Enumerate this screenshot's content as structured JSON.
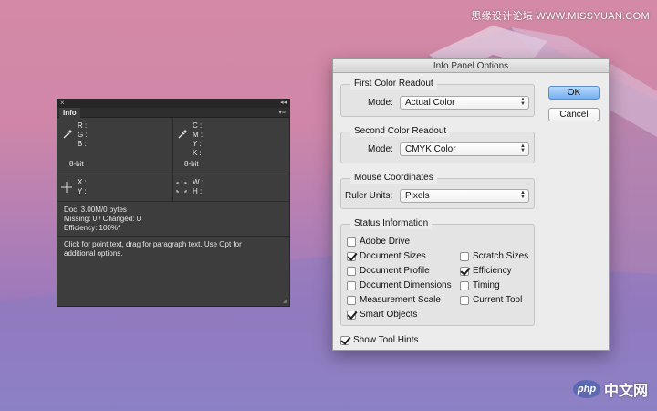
{
  "watermark": {
    "top_text": "思缘设计论坛 WWW.MISSYUAN.COM",
    "logo_text": "php",
    "logo_cn": "中文网"
  },
  "info_panel": {
    "close_glyph": "×",
    "collapse_glyph": "◂◂",
    "tab_label": "Info",
    "menu_glyph": "▾≡",
    "rgb_labels": [
      "R :",
      "G :",
      "B :"
    ],
    "rgb_bitdepth": "8-bit",
    "cmyk_labels": [
      "C :",
      "M :",
      "Y :",
      "K :"
    ],
    "cmyk_bitdepth": "8-bit",
    "xy_labels": [
      "X :",
      "Y :"
    ],
    "wh_labels": [
      "W :",
      "H :"
    ],
    "status_lines": [
      "Doc: 3.00M/0 bytes",
      "Missing: 0 / Changed: 0",
      "Efficiency: 100%*"
    ],
    "hint_lines": [
      "Click for point text, drag for paragraph text.  Use Opt for",
      "additional options."
    ]
  },
  "dialog": {
    "title": "Info Panel Options",
    "ok_label": "OK",
    "cancel_label": "Cancel",
    "first_readout": {
      "group_label": "First Color Readout",
      "mode_label": "Mode:",
      "mode_value": "Actual Color"
    },
    "second_readout": {
      "group_label": "Second Color Readout",
      "mode_label": "Mode:",
      "mode_value": "CMYK Color"
    },
    "mouse": {
      "group_label": "Mouse Coordinates",
      "units_label": "Ruler Units:",
      "units_value": "Pixels"
    },
    "status": {
      "group_label": "Status Information",
      "left": [
        {
          "label": "Adobe Drive",
          "checked": false
        },
        {
          "label": "Document Sizes",
          "checked": true
        },
        {
          "label": "Document Profile",
          "checked": false
        },
        {
          "label": "Document Dimensions",
          "checked": false
        },
        {
          "label": "Measurement Scale",
          "checked": false
        },
        {
          "label": "Smart Objects",
          "checked": true
        }
      ],
      "right": [
        {
          "label": "Scratch Sizes",
          "checked": false
        },
        {
          "label": "Efficiency",
          "checked": true
        },
        {
          "label": "Timing",
          "checked": false
        },
        {
          "label": "Current Tool",
          "checked": false
        }
      ]
    },
    "show_tool_hints": {
      "label": "Show Tool Hints",
      "checked": true
    }
  }
}
